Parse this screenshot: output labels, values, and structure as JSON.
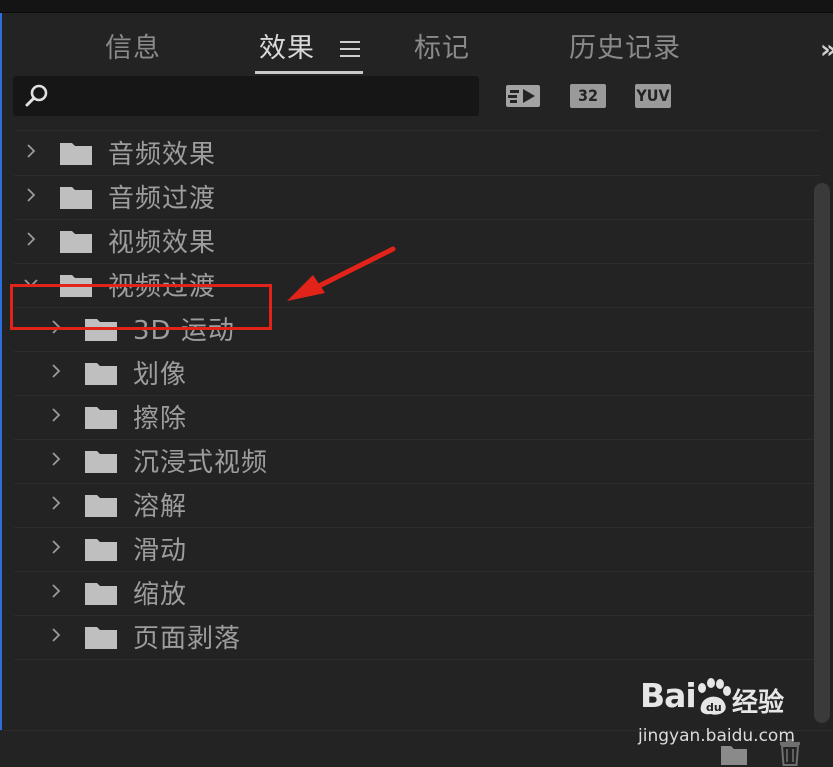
{
  "tabs": [
    {
      "label": "信息"
    },
    {
      "label": "效果"
    },
    {
      "label": "标记"
    },
    {
      "label": "历史记录"
    }
  ],
  "active_tab": "效果",
  "overflow_label": "»",
  "search": {
    "value": "",
    "placeholder": ""
  },
  "filter_buttons": [
    "32",
    "YUV"
  ],
  "tree": {
    "items": [
      {
        "label": "音频效果",
        "expanded": false
      },
      {
        "label": "音频过渡",
        "expanded": false
      },
      {
        "label": "视频效果",
        "expanded": false
      },
      {
        "label": "视频过渡",
        "expanded": true
      }
    ],
    "children": [
      {
        "label": "3D 运动"
      },
      {
        "label": "划像"
      },
      {
        "label": "擦除"
      },
      {
        "label": "沉浸式视频"
      },
      {
        "label": "溶解"
      },
      {
        "label": "滑动"
      },
      {
        "label": "缩放"
      },
      {
        "label": "页面剥落"
      }
    ]
  },
  "annotation": {
    "color": "#e2231a"
  },
  "watermark": {
    "brand": "Bai",
    "brand_cn": "经验",
    "url": "jingyan.baidu.com"
  },
  "colors": {
    "accent": "#2d6cdf",
    "panel_bg": "#232323",
    "text": "#9d9d9d"
  }
}
